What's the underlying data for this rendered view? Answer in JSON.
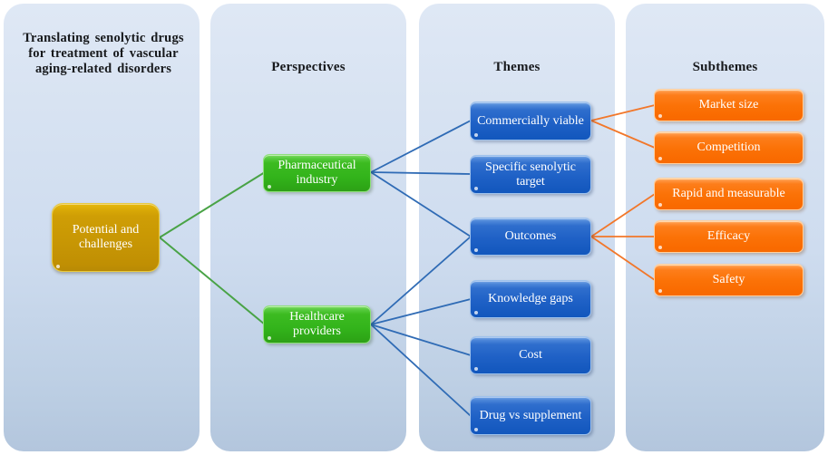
{
  "columns": [
    {
      "id": "goal",
      "title": "Translating senolytic drugs for treatment of vascular aging-related disorders"
    },
    {
      "id": "perspectives",
      "title": "Perspectives"
    },
    {
      "id": "themes",
      "title": "Themes"
    },
    {
      "id": "subthemes",
      "title": "Subthemes"
    }
  ],
  "goal": {
    "node_label": "Potential and challenges"
  },
  "perspectives": {
    "items": [
      {
        "label": "Pharmaceutical industry"
      },
      {
        "label": "Healthcare providers"
      }
    ]
  },
  "themes": {
    "items": [
      {
        "label": "Commercially viable"
      },
      {
        "label": "Specific senolytic target"
      },
      {
        "label": "Outcomes"
      },
      {
        "label": "Knowledge gaps"
      },
      {
        "label": "Cost"
      },
      {
        "label": "Drug vs supplement"
      }
    ]
  },
  "subthemes": {
    "items": [
      {
        "label": "Market size"
      },
      {
        "label": "Competition"
      },
      {
        "label": "Rapid and measurable"
      },
      {
        "label": "Efficacy"
      },
      {
        "label": "Safety"
      }
    ]
  },
  "colors": {
    "panel_top": "#dfe8f5",
    "panel_bottom": "#b3c6dd",
    "goal_node": "#c89704",
    "perspective_node": "#33b41b",
    "theme_node": "#1f61c6",
    "subtheme_node": "#fb7207",
    "link_goal_to_perspective": "#49a346",
    "link_perspective_to_theme": "#2f6bb5",
    "link_theme_to_subtheme": "#f2772a",
    "node_text": "#ffffff",
    "title_text": "#17191c"
  }
}
